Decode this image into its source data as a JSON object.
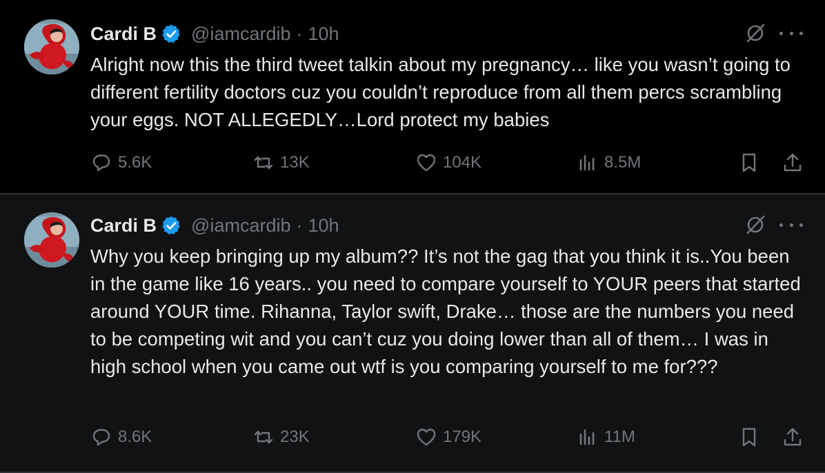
{
  "tweets": [
    {
      "author": {
        "name": "Cardi B",
        "handle": "@iamcardib",
        "separator": "·",
        "time": "10h"
      },
      "text": "Alright now this the third tweet talkin about my pregnancy… like you wasn’t going to different fertility doctors cuz you couldn’t reproduce from all them percs scrambling your eggs. NOT ALLEGEDLY…Lord protect my babies",
      "stats": {
        "replies": "5.6K",
        "reposts": "13K",
        "likes": "104K",
        "views": "8.5M"
      }
    },
    {
      "author": {
        "name": "Cardi B",
        "handle": "@iamcardib",
        "separator": "·",
        "time": "10h"
      },
      "text": "Why you keep bringing up my album?? It’s not the gag that you think it is..You been in the game like 16 years.. you need to compare yourself to YOUR peers that started around YOUR time. Rihanna, Taylor swift, Drake… those are the numbers you need to be competing wit and you can’t cuz you doing lower than all of them… I was in high school when you came out wtf is you comparing yourself to me for???",
      "stats": {
        "replies": "8.6K",
        "reposts": "23K",
        "likes": "179K",
        "views": "11M"
      }
    }
  ],
  "colors": {
    "background": "#000000",
    "background_alt": "#111213",
    "text_primary": "#e7e9ea",
    "text_secondary": "#71767b",
    "verified_blue": "#1d9bf0",
    "divider": "#2f3336"
  },
  "icons": [
    "verified-badge-icon",
    "grok-icon",
    "more-icon",
    "reply-icon",
    "repost-icon",
    "like-icon",
    "views-icon",
    "bookmark-icon",
    "share-icon"
  ]
}
